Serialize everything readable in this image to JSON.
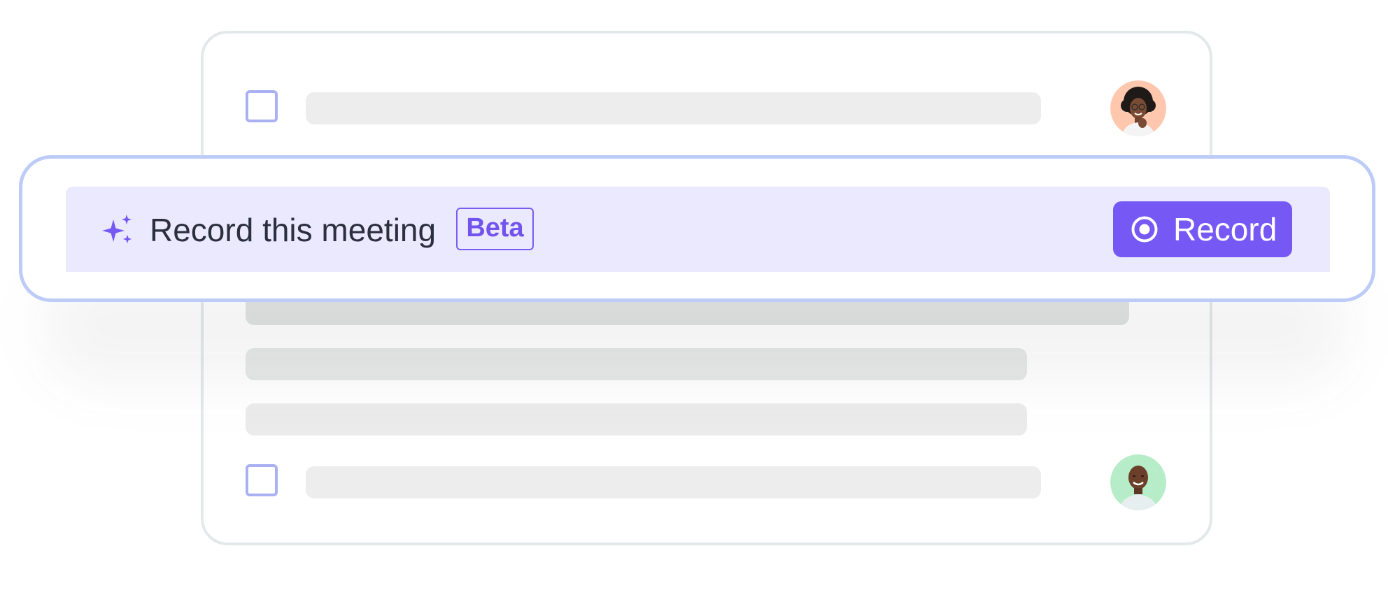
{
  "banner": {
    "title": "Record this meeting",
    "badge": "Beta",
    "record_button_label": "Record",
    "sparkle_icon": "sparkle-icon",
    "record_icon": "record-circle-icon"
  },
  "list": {
    "rows": [
      {
        "type": "task",
        "checked": false,
        "avatar": "woman-avatar",
        "avatar_bg": "#ffc7ad"
      },
      {
        "type": "skeleton"
      },
      {
        "type": "skeleton"
      },
      {
        "type": "skeleton"
      },
      {
        "type": "task",
        "checked": false,
        "avatar": "man-avatar",
        "avatar_bg": "#b6ecc7"
      }
    ]
  },
  "colors": {
    "accent": "#7658f4",
    "banner_bg": "#ebe9fd",
    "banner_border": "#bccbf7",
    "checkbox_border": "#a9b1f3",
    "skeleton": "#ededed",
    "title_text": "#2b2f3e"
  }
}
